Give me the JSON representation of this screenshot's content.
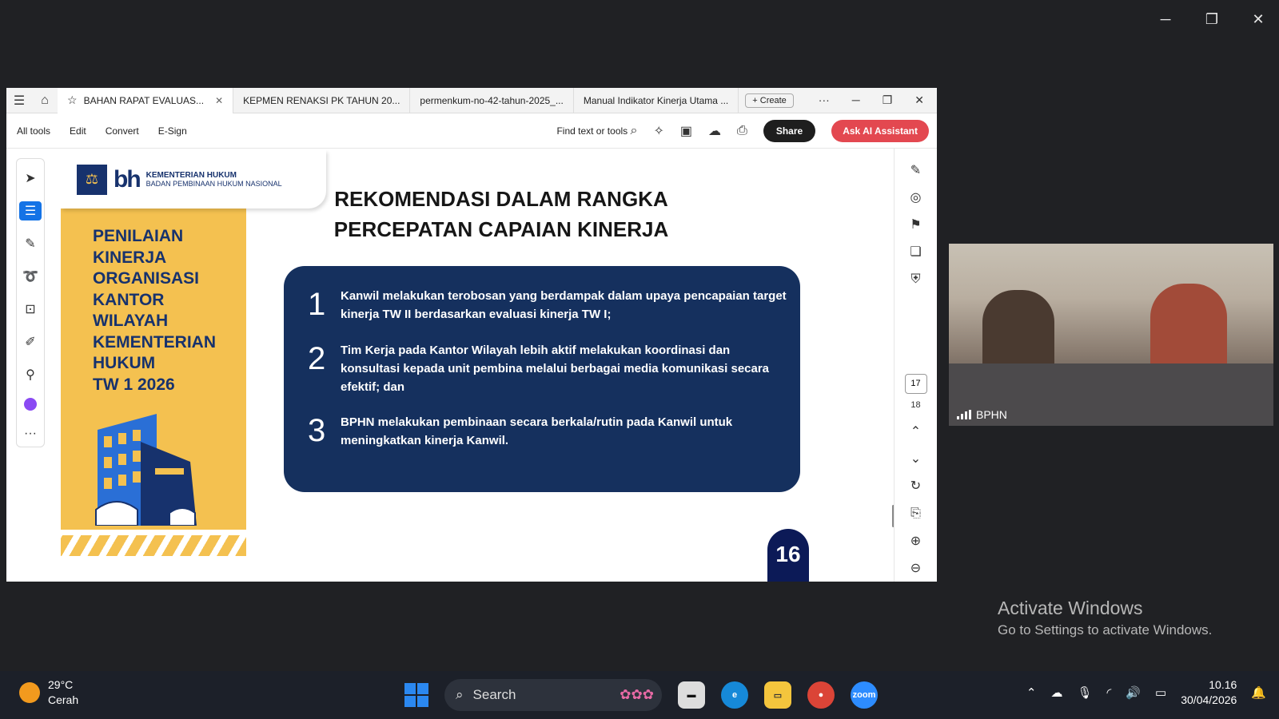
{
  "outer_controls": {
    "minimize": "─",
    "restore": "❐",
    "close": "✕"
  },
  "acrobat": {
    "tabs": [
      {
        "label": "BAHAN RAPAT EVALUAS...",
        "active": true
      },
      {
        "label": "KEPMEN RENAKSI PK TAHUN 20..."
      },
      {
        "label": "permenkum-no-42-tahun-2025_..."
      },
      {
        "label": "Manual Indikator Kinerja Utama ..."
      }
    ],
    "create_label": "Create",
    "menu": [
      "All tools",
      "Edit",
      "Convert",
      "E-Sign"
    ],
    "find_label": "Find text or tools",
    "share_label": "Share",
    "ai_label": "Ask AI Assistant",
    "current_page": "17",
    "total_page": "18"
  },
  "slide": {
    "logo_ministry": "KEMENTERIAN HUKUM",
    "logo_agency": "BADAN PEMBINAAN HUKUM NASIONAL",
    "side_title": [
      "PENILAIAN",
      "KINERJA",
      "ORGANISASI",
      "KANTOR",
      "WILAYAH",
      "KEMENTERIAN",
      "HUKUM",
      "TW 1 2026"
    ],
    "title_line1": "REKOMENDASI DALAM RANGKA",
    "title_line2": "PERCEPATAN CAPAIAN KINERJA",
    "items": [
      {
        "num": "1",
        "text": "Kanwil melakukan terobosan yang berdampak dalam upaya pencapaian target kinerja TW II berdasarkan evaluasi kinerja TW I;"
      },
      {
        "num": "2",
        "text": "Tim Kerja pada Kantor Wilayah lebih aktif melakukan koordinasi dan konsultasi kepada unit pembina melalui berbagai media komunikasi secara efektif; dan"
      },
      {
        "num": "3",
        "text": "BPHN melakukan pembinaan secara berkala/rutin pada Kanwil untuk meningkatkan kinerja Kanwil."
      }
    ],
    "page_number": "16"
  },
  "video": {
    "participant": "BPHN"
  },
  "watermark": {
    "line1": "Activate Windows",
    "line2": "Go to Settings to activate Windows."
  },
  "taskbar": {
    "temperature": "29°C",
    "weather": "Cerah",
    "search_placeholder": "Search",
    "time": "10.16",
    "date": "30/04/2026"
  }
}
